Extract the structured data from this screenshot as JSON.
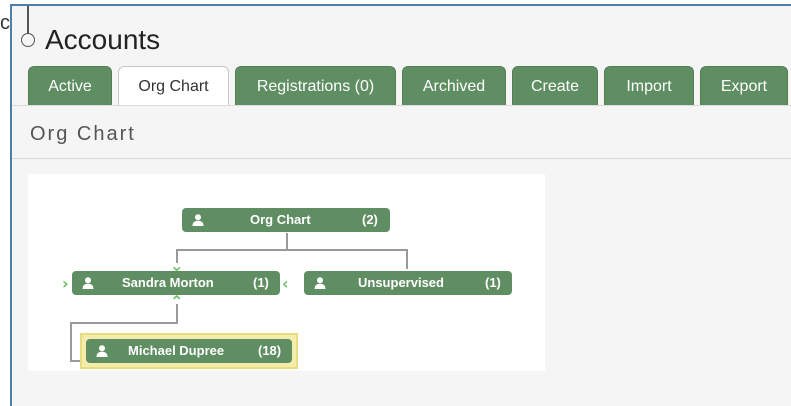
{
  "stray_letter": "c",
  "page_title": "Accounts",
  "tabs": [
    {
      "label": "Active",
      "active": false
    },
    {
      "label": "Org Chart",
      "active": true
    },
    {
      "label": "Registrations (0)",
      "active": false
    },
    {
      "label": "Archived",
      "active": false
    },
    {
      "label": "Create",
      "active": false
    },
    {
      "label": "Import",
      "active": false
    },
    {
      "label": "Export",
      "active": false
    }
  ],
  "section_title": "Org Chart",
  "org_chart": {
    "root": {
      "label": "Org Chart",
      "count": "(2)",
      "icon": "person-icon"
    },
    "children": [
      {
        "label": "Sandra Morton",
        "count": "(1)",
        "icon": "person-icon"
      },
      {
        "label": "Unsupervised",
        "count": "(1)",
        "icon": "person-icon"
      }
    ],
    "grandchild": {
      "label": "Michael Dupree",
      "count": "(18)",
      "icon": "person-icon",
      "highlighted": true
    }
  },
  "colors": {
    "tab_green": "#5f8e62",
    "node_green": "#5f8e62",
    "arrow_green": "#6cbf64",
    "highlight": "#f3ecac",
    "frame_blue": "#4f7fa8"
  }
}
